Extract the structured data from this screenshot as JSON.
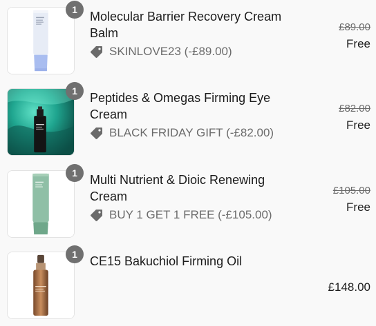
{
  "items": [
    {
      "quantity": "1",
      "title": "Molecular Barrier Recovery Cream Balm",
      "discount": "SKINLOVE23 (-£89.00)",
      "original_price": "£89.00",
      "price": "Free"
    },
    {
      "quantity": "1",
      "title": "Peptides & Omegas Firming Eye Cream",
      "discount": "BLACK FRIDAY GIFT (-£82.00)",
      "original_price": "£82.00",
      "price": "Free"
    },
    {
      "quantity": "1",
      "title": "Multi Nutrient & Dioic Renewing Cream",
      "discount": "BUY 1 GET 1 FREE (-£105.00)",
      "original_price": "£105.00",
      "price": "Free"
    },
    {
      "quantity": "1",
      "title": "CE15 Bakuchiol Firming Oil",
      "price": "£148.00"
    }
  ],
  "colors": {
    "quantity_badge": "#707070",
    "muted_text": "#6b6b6b",
    "primary_text": "#1c1c1c",
    "thumbnail_border": "#e3e3e3"
  },
  "icons": {
    "discount": "price-tag-icon"
  }
}
